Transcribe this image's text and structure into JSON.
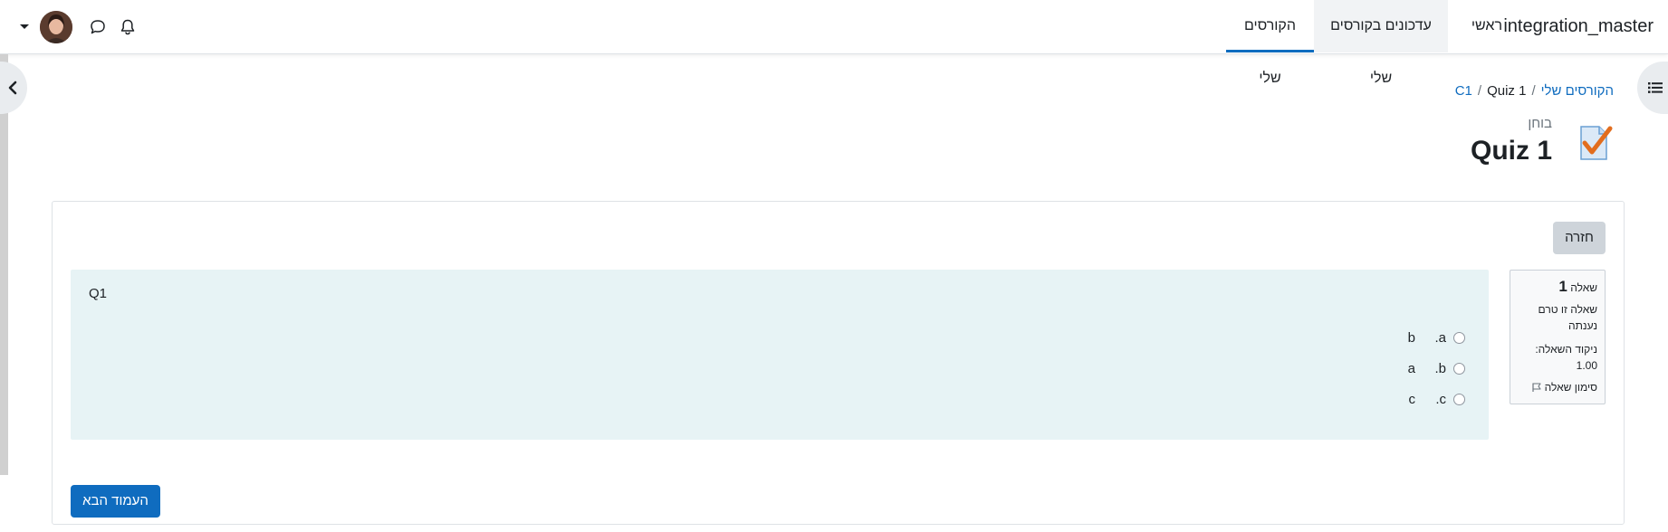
{
  "navbar": {
    "brand": "integration_master",
    "home": "ראשי",
    "updates": "עדכונים בקורסים שלי",
    "my_courses": "הקורסים שלי"
  },
  "breadcrumb": {
    "my_courses": "הקורסים שלי",
    "separator": "/",
    "course": "C1",
    "current": "Quiz 1"
  },
  "header": {
    "module_type": "בוחן",
    "title": "Quiz 1"
  },
  "card": {
    "return_label": "חזרה",
    "next_label": "העמוד הבא"
  },
  "question_info": {
    "number_label": "שאלה",
    "number": "1",
    "state": "שאלה זו טרם נענתה",
    "grade_label": "ניקוד השאלה:",
    "grade_value": "1.00",
    "flag_label": "סימון שאלה"
  },
  "question": {
    "text": "Q1",
    "answers": [
      {
        "letter": "a.",
        "text": "b"
      },
      {
        "letter": "b.",
        "text": "a"
      },
      {
        "letter": "c.",
        "text": "c"
      }
    ]
  },
  "colors": {
    "accent": "#0f6cbf",
    "formulation_bg": "#e7f3f5",
    "secondary_btn": "#ced4da"
  }
}
